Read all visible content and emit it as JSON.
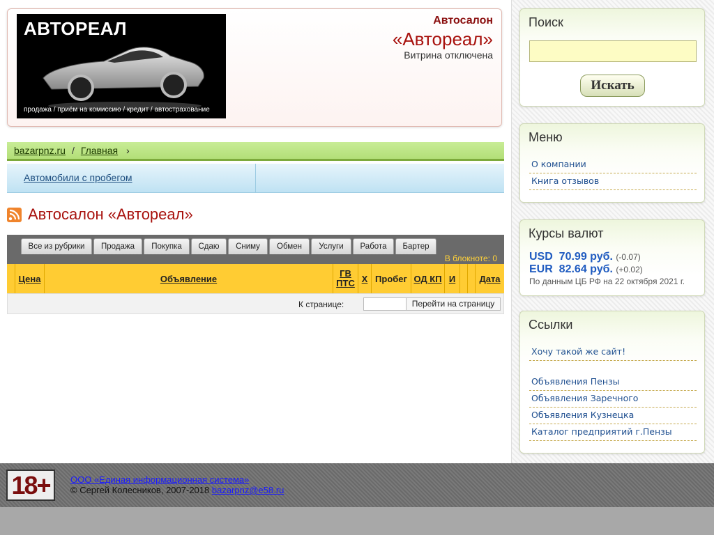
{
  "header": {
    "logo_title": "АВТОРЕАЛ",
    "logo_tagline": "продажа / приём на комиссию / кредит / автострахование",
    "shop_type": "Автосалон",
    "shop_name": "«Автореал»",
    "status": "Витрина отключена"
  },
  "breadcrumb": {
    "site": "bazarpnz.ru",
    "sep": "/",
    "home": "Главная",
    "arrow": "›"
  },
  "category": {
    "link": "Автомобили с пробегом"
  },
  "page_title": "Автосалон «Автореал»",
  "tabs": [
    "Все из рубрики",
    "Продажа",
    "Покупка",
    "Сдаю",
    "Сниму",
    "Обмен",
    "Услуги",
    "Работа",
    "Бартер"
  ],
  "notebook": "В блокноте: 0",
  "table_headers": {
    "price": "Цена",
    "ad": "Объявление",
    "gv": "ГВ",
    "pts": "ПТС",
    "x": "Х",
    "mileage": "Пробег",
    "od_kp": "ОД КП",
    "i": "И",
    "date": "Дата"
  },
  "pager": {
    "label": "К странице:",
    "input_value": "",
    "button": "Перейти на страницу"
  },
  "sidebar": {
    "search": {
      "title": "Поиск",
      "value": "",
      "button": "Искать"
    },
    "menu": {
      "title": "Меню",
      "items": [
        "О компании",
        "Книга отзывов"
      ]
    },
    "rates": {
      "title": "Курсы валют",
      "usd": {
        "code": "USD",
        "value": "70.99 руб.",
        "change": "(-0.07)"
      },
      "eur": {
        "code": "EUR",
        "value": "82.64 руб.",
        "change": "(+0.02)"
      },
      "source": "По данным ЦБ РФ на 22 октября 2021 г."
    },
    "links": {
      "title": "Ссылки",
      "items": [
        "Хочу такой же сайт!",
        "Объявления Пензы",
        "Объявления Заречного",
        "Объявления Кузнецка",
        "Каталог предприятий г.Пензы"
      ]
    }
  },
  "footer": {
    "age": "18+",
    "company": "ООО «Единая информационная система»",
    "copyright": "© Сергей Колесников, 2007-2018",
    "email": "bazarpnz@e58.ru"
  }
}
